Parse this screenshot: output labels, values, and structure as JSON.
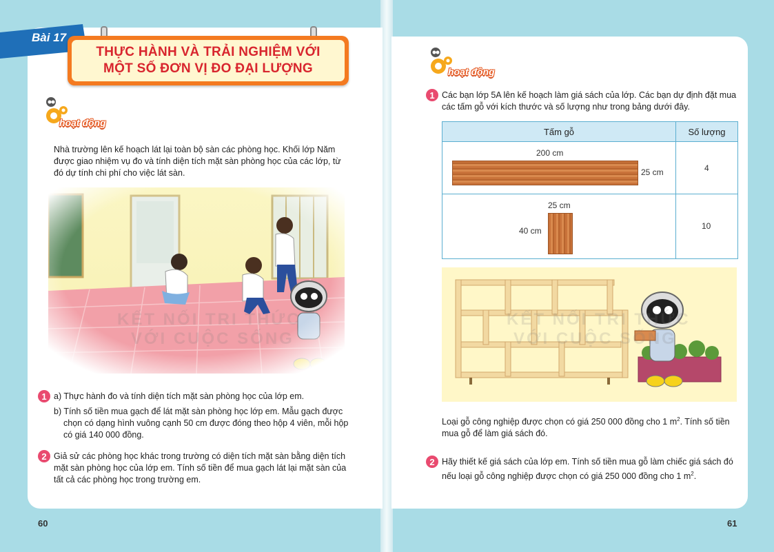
{
  "lesson": {
    "tab_label": "Bài 17",
    "title_line1": "THỰC HÀNH VÀ TRẢI NGHIỆM VỚI",
    "title_line2": "MỘT SỐ ĐƠN VỊ ĐO ĐẠI LƯỢNG"
  },
  "badge_label": "hoạt động",
  "left": {
    "intro": "Nhà trường lên kế hoạch lát lại toàn bộ sàn các phòng học. Khối lớp Năm được giao nhiệm vụ đo và tính diện tích mặt sàn phòng học của các lớp, từ đó dự tính chi phí cho việc lát sàn.",
    "task1_number": "1",
    "task1_a": "a) Thực hành đo và tính diện tích mặt sàn phòng học của lớp em.",
    "task1_b": "b) Tính số tiền mua gạch để lát mặt sàn phòng học lớp em. Mẫu gạch được chọn có dạng hình vuông cạnh 50 cm được đóng theo hộp 4 viên, mỗi hộp có giá 140 000 đồng.",
    "task2_number": "2",
    "task2": "Giả sử các phòng học khác trong trường có diện tích mặt sàn bằng diện tích mặt sàn phòng học của lớp em. Tính số tiền để mua gạch lát lại mặt sàn của tất cả các phòng học trong trường em.",
    "page_number": "60"
  },
  "right": {
    "task1_number": "1",
    "task1_intro": "Các bạn lớp 5A lên kế hoạch làm giá sách của lớp. Các bạn dự định đặt mua các tấm gỗ với kích thước và số lượng như trong bảng dưới đây.",
    "table": {
      "col1": "Tấm gỗ",
      "col2": "Số lượng",
      "row1": {
        "length": "200 cm",
        "width": "25 cm",
        "qty": "4"
      },
      "row2": {
        "top": "25 cm",
        "side": "40 cm",
        "qty": "10"
      }
    },
    "task1_question_pre": "Loại gỗ công nghiệp được chọn có giá 250 000 đồng cho 1 m",
    "task1_question_sup": "2",
    "task1_question_post": ". Tính số tiền mua gỗ để làm giá sách đó.",
    "task2_number": "2",
    "task2_pre": "Hãy thiết kế giá sách của lớp em. Tính số tiền mua gỗ làm chiếc giá sách đó nếu loại gỗ công nghiệp được chọn có giá 250 000 đồng cho 1 m",
    "task2_sup": "2",
    "task2_post": ".",
    "page_number": "61"
  },
  "watermark": {
    "line1": "KẾT NỐI TRI THỨC",
    "line2": "VỚI CUỘC SỐNG"
  },
  "colors": {
    "background": "#a9dce6",
    "title_orange": "#f47a20",
    "title_red": "#d8252e",
    "number_pink": "#e94a6f",
    "tab_blue": "#1f6fb8",
    "table_border": "#5aaed0"
  }
}
